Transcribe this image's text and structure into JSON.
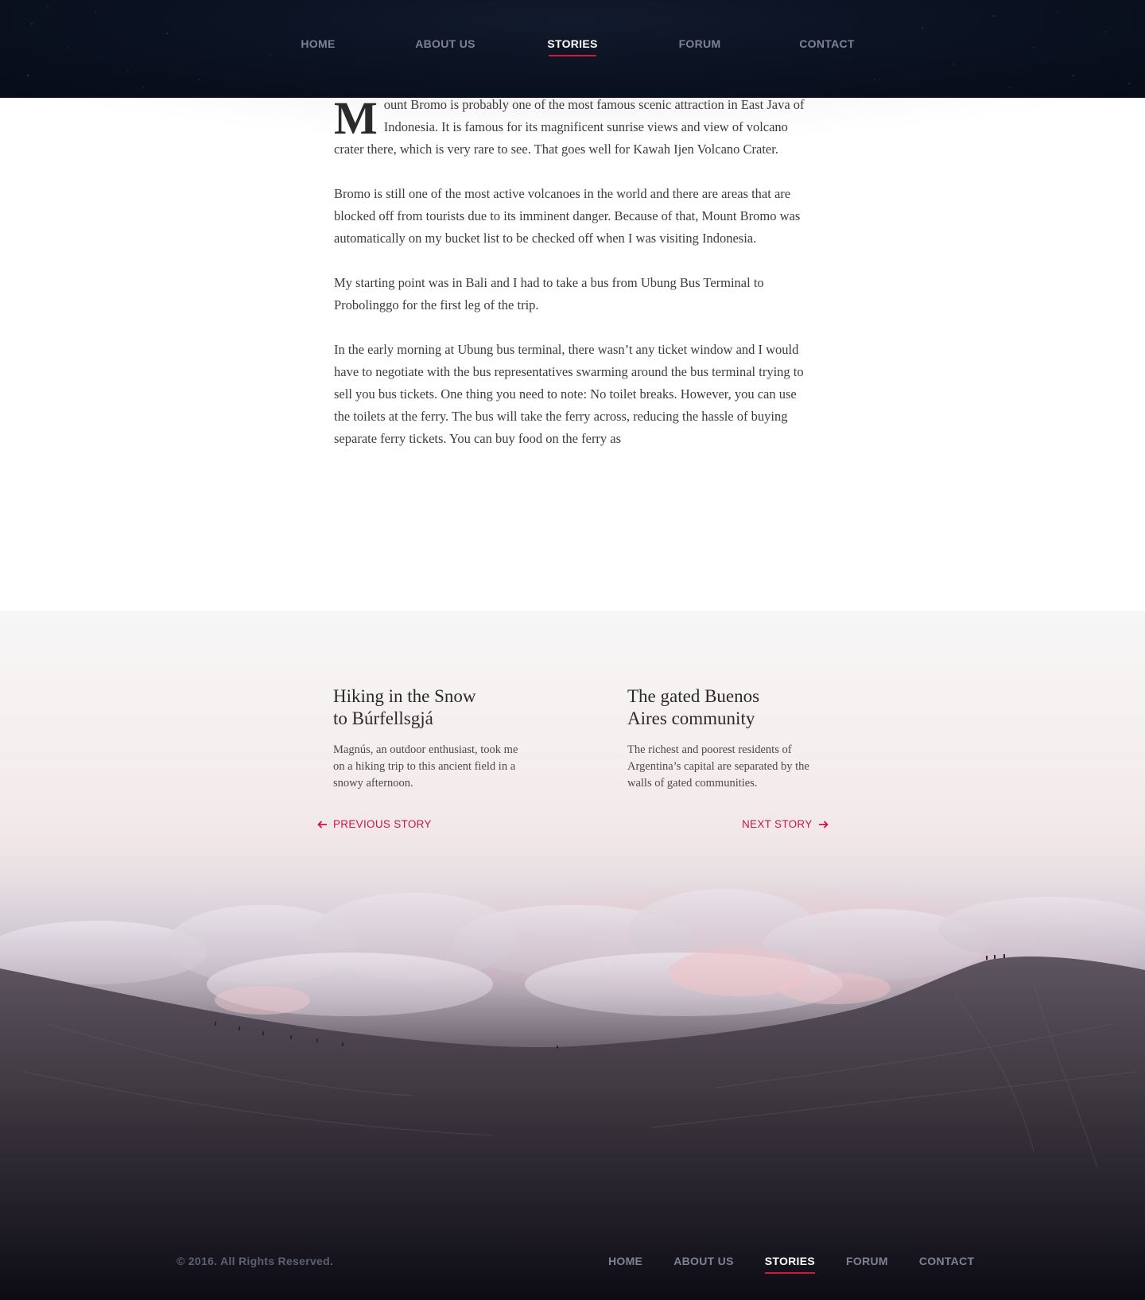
{
  "nav": {
    "items": [
      {
        "label": "HOME"
      },
      {
        "label": "ABOUT US"
      },
      {
        "label": "STORIES"
      },
      {
        "label": "FORUM"
      },
      {
        "label": "CONTACT"
      }
    ],
    "active": "STORIES"
  },
  "article": {
    "dropcap": "M",
    "first_paragraph_rest": "ount Bromo is probably one of the most famous scenic attraction in East Java of Indonesia. It is famous for its magnificent sunrise views and view of volcano crater there, which is very rare to see. That goes well for Kawah Ijen Volcano Crater.",
    "paragraphs": [
      "Bromo is still one of the most active volcanoes in the world and there are areas that are blocked off from tourists due to its imminent danger. Because of that, Mount Bromo was automatically on my bucket list to be checked off when I was visiting Indonesia.",
      "My starting point was in Bali and I had to take a bus from Ubung Bus Terminal to Probolinggo for the first leg of the trip.",
      "In the early morning at Ubung bus terminal, there wasn’t any ticket window and I would have to negotiate with the bus representatives swarming around the bus terminal trying to sell you bus tickets. One thing you need to note: No toilet breaks. However, you can use the toilets at the ferry. The bus will take the ferry across, reducing the hassle of buying separate ferry tickets. You can buy food on the ferry as"
    ]
  },
  "stories": {
    "previous": {
      "title_line1": "Hiking in the Snow",
      "title_line2": "to Búrfellsgjá",
      "excerpt": "Magnús, an outdoor enthusiast, took me on a hiking trip to this ancient field in a snowy afternoon.",
      "link_label": "PREVIOUS STORY"
    },
    "next": {
      "title_line1": "The gated Buenos",
      "title_line2": "Aires community",
      "excerpt": "The richest and poorest residents of Argentina’s capital are separated by the walls of gated communities.",
      "link_label": "NEXT STORY"
    }
  },
  "footer": {
    "copyright": "© 2016. All Rights Reserved.",
    "nav": [
      "HOME",
      "ABOUT US",
      "STORIES",
      "FORUM",
      "CONTACT"
    ],
    "active": "STORIES"
  },
  "colors": {
    "accent": "#d01843",
    "header_bg": "#0a1120",
    "nav_text": "#7e8296",
    "nav_active": "#ffffff"
  },
  "icons": {
    "previous": "arrow-left-icon",
    "next": "arrow-right-icon"
  }
}
